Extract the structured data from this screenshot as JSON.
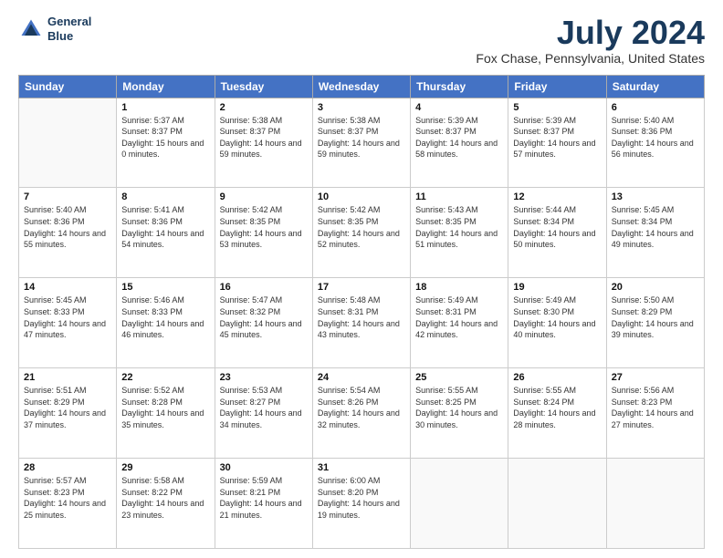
{
  "logo": {
    "text_line1": "General",
    "text_line2": "Blue"
  },
  "header": {
    "title": "July 2024",
    "subtitle": "Fox Chase, Pennsylvania, United States"
  },
  "days_of_week": [
    "Sunday",
    "Monday",
    "Tuesday",
    "Wednesday",
    "Thursday",
    "Friday",
    "Saturday"
  ],
  "weeks": [
    [
      {
        "day": "",
        "empty": true
      },
      {
        "day": "1",
        "sunrise": "Sunrise: 5:37 AM",
        "sunset": "Sunset: 8:37 PM",
        "daylight": "Daylight: 15 hours and 0 minutes."
      },
      {
        "day": "2",
        "sunrise": "Sunrise: 5:38 AM",
        "sunset": "Sunset: 8:37 PM",
        "daylight": "Daylight: 14 hours and 59 minutes."
      },
      {
        "day": "3",
        "sunrise": "Sunrise: 5:38 AM",
        "sunset": "Sunset: 8:37 PM",
        "daylight": "Daylight: 14 hours and 59 minutes."
      },
      {
        "day": "4",
        "sunrise": "Sunrise: 5:39 AM",
        "sunset": "Sunset: 8:37 PM",
        "daylight": "Daylight: 14 hours and 58 minutes."
      },
      {
        "day": "5",
        "sunrise": "Sunrise: 5:39 AM",
        "sunset": "Sunset: 8:37 PM",
        "daylight": "Daylight: 14 hours and 57 minutes."
      },
      {
        "day": "6",
        "sunrise": "Sunrise: 5:40 AM",
        "sunset": "Sunset: 8:36 PM",
        "daylight": "Daylight: 14 hours and 56 minutes."
      }
    ],
    [
      {
        "day": "7",
        "sunrise": "Sunrise: 5:40 AM",
        "sunset": "Sunset: 8:36 PM",
        "daylight": "Daylight: 14 hours and 55 minutes."
      },
      {
        "day": "8",
        "sunrise": "Sunrise: 5:41 AM",
        "sunset": "Sunset: 8:36 PM",
        "daylight": "Daylight: 14 hours and 54 minutes."
      },
      {
        "day": "9",
        "sunrise": "Sunrise: 5:42 AM",
        "sunset": "Sunset: 8:35 PM",
        "daylight": "Daylight: 14 hours and 53 minutes."
      },
      {
        "day": "10",
        "sunrise": "Sunrise: 5:42 AM",
        "sunset": "Sunset: 8:35 PM",
        "daylight": "Daylight: 14 hours and 52 minutes."
      },
      {
        "day": "11",
        "sunrise": "Sunrise: 5:43 AM",
        "sunset": "Sunset: 8:35 PM",
        "daylight": "Daylight: 14 hours and 51 minutes."
      },
      {
        "day": "12",
        "sunrise": "Sunrise: 5:44 AM",
        "sunset": "Sunset: 8:34 PM",
        "daylight": "Daylight: 14 hours and 50 minutes."
      },
      {
        "day": "13",
        "sunrise": "Sunrise: 5:45 AM",
        "sunset": "Sunset: 8:34 PM",
        "daylight": "Daylight: 14 hours and 49 minutes."
      }
    ],
    [
      {
        "day": "14",
        "sunrise": "Sunrise: 5:45 AM",
        "sunset": "Sunset: 8:33 PM",
        "daylight": "Daylight: 14 hours and 47 minutes."
      },
      {
        "day": "15",
        "sunrise": "Sunrise: 5:46 AM",
        "sunset": "Sunset: 8:33 PM",
        "daylight": "Daylight: 14 hours and 46 minutes."
      },
      {
        "day": "16",
        "sunrise": "Sunrise: 5:47 AM",
        "sunset": "Sunset: 8:32 PM",
        "daylight": "Daylight: 14 hours and 45 minutes."
      },
      {
        "day": "17",
        "sunrise": "Sunrise: 5:48 AM",
        "sunset": "Sunset: 8:31 PM",
        "daylight": "Daylight: 14 hours and 43 minutes."
      },
      {
        "day": "18",
        "sunrise": "Sunrise: 5:49 AM",
        "sunset": "Sunset: 8:31 PM",
        "daylight": "Daylight: 14 hours and 42 minutes."
      },
      {
        "day": "19",
        "sunrise": "Sunrise: 5:49 AM",
        "sunset": "Sunset: 8:30 PM",
        "daylight": "Daylight: 14 hours and 40 minutes."
      },
      {
        "day": "20",
        "sunrise": "Sunrise: 5:50 AM",
        "sunset": "Sunset: 8:29 PM",
        "daylight": "Daylight: 14 hours and 39 minutes."
      }
    ],
    [
      {
        "day": "21",
        "sunrise": "Sunrise: 5:51 AM",
        "sunset": "Sunset: 8:29 PM",
        "daylight": "Daylight: 14 hours and 37 minutes."
      },
      {
        "day": "22",
        "sunrise": "Sunrise: 5:52 AM",
        "sunset": "Sunset: 8:28 PM",
        "daylight": "Daylight: 14 hours and 35 minutes."
      },
      {
        "day": "23",
        "sunrise": "Sunrise: 5:53 AM",
        "sunset": "Sunset: 8:27 PM",
        "daylight": "Daylight: 14 hours and 34 minutes."
      },
      {
        "day": "24",
        "sunrise": "Sunrise: 5:54 AM",
        "sunset": "Sunset: 8:26 PM",
        "daylight": "Daylight: 14 hours and 32 minutes."
      },
      {
        "day": "25",
        "sunrise": "Sunrise: 5:55 AM",
        "sunset": "Sunset: 8:25 PM",
        "daylight": "Daylight: 14 hours and 30 minutes."
      },
      {
        "day": "26",
        "sunrise": "Sunrise: 5:55 AM",
        "sunset": "Sunset: 8:24 PM",
        "daylight": "Daylight: 14 hours and 28 minutes."
      },
      {
        "day": "27",
        "sunrise": "Sunrise: 5:56 AM",
        "sunset": "Sunset: 8:23 PM",
        "daylight": "Daylight: 14 hours and 27 minutes."
      }
    ],
    [
      {
        "day": "28",
        "sunrise": "Sunrise: 5:57 AM",
        "sunset": "Sunset: 8:23 PM",
        "daylight": "Daylight: 14 hours and 25 minutes."
      },
      {
        "day": "29",
        "sunrise": "Sunrise: 5:58 AM",
        "sunset": "Sunset: 8:22 PM",
        "daylight": "Daylight: 14 hours and 23 minutes."
      },
      {
        "day": "30",
        "sunrise": "Sunrise: 5:59 AM",
        "sunset": "Sunset: 8:21 PM",
        "daylight": "Daylight: 14 hours and 21 minutes."
      },
      {
        "day": "31",
        "sunrise": "Sunrise: 6:00 AM",
        "sunset": "Sunset: 8:20 PM",
        "daylight": "Daylight: 14 hours and 19 minutes."
      },
      {
        "day": "",
        "empty": true
      },
      {
        "day": "",
        "empty": true
      },
      {
        "day": "",
        "empty": true
      }
    ]
  ]
}
